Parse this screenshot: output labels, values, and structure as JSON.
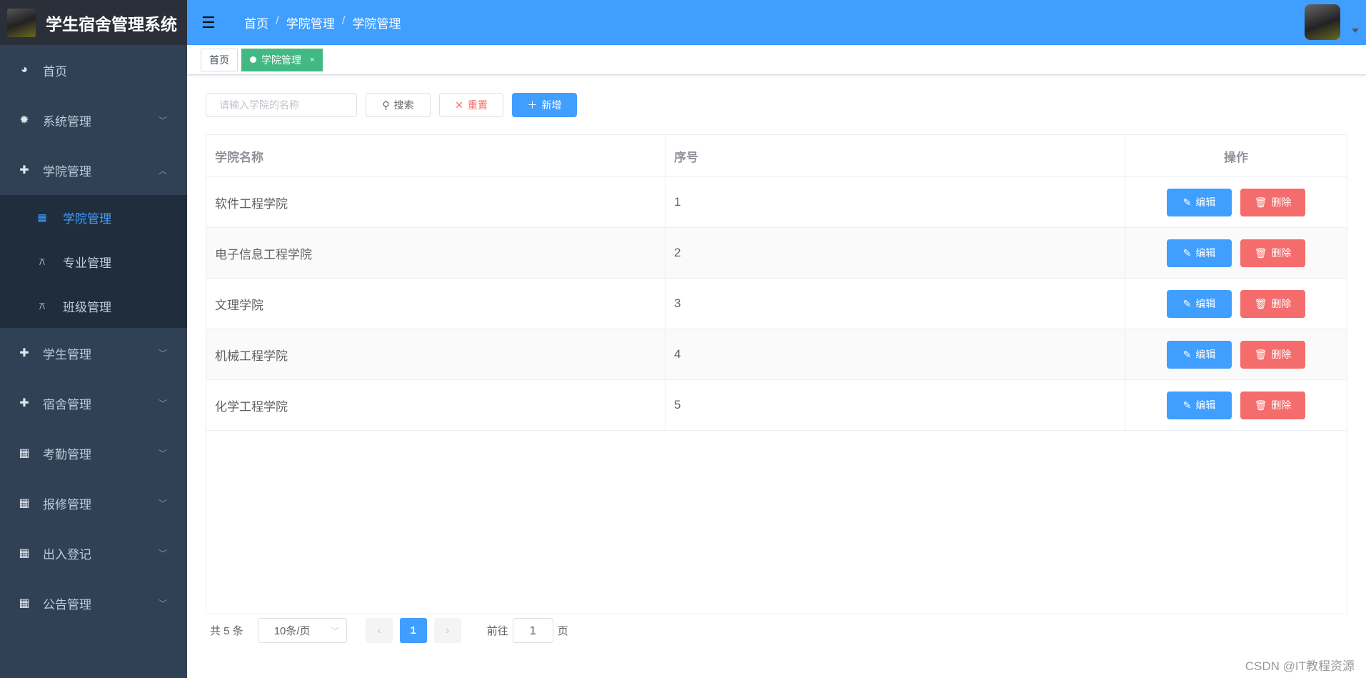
{
  "app": {
    "title": "学生宿舍管理系统"
  },
  "sidebar": {
    "items": [
      {
        "label": "首页",
        "icon": "dashboard-icon",
        "glyph": "◕"
      },
      {
        "label": "系统管理",
        "icon": "gear-icon",
        "glyph": "✹"
      },
      {
        "label": "学院管理",
        "icon": "circle-plus-icon",
        "glyph": "✚"
      },
      {
        "label": "学生管理",
        "icon": "circle-plus-icon",
        "glyph": "✚"
      },
      {
        "label": "宿舍管理",
        "icon": "circle-plus-icon",
        "glyph": "✚"
      },
      {
        "label": "考勤管理",
        "icon": "table-icon",
        "glyph": "▦"
      },
      {
        "label": "报修管理",
        "icon": "table-icon",
        "glyph": "▦"
      },
      {
        "label": "出入登记",
        "icon": "table-icon",
        "glyph": "▦"
      },
      {
        "label": "公告管理",
        "icon": "table-icon",
        "glyph": "▦"
      }
    ],
    "submenu": [
      {
        "label": "学院管理"
      },
      {
        "label": "专业管理"
      },
      {
        "label": "班级管理"
      }
    ]
  },
  "header": {
    "breadcrumb": [
      "首页",
      "学院管理",
      "学院管理"
    ],
    "separator": "/"
  },
  "tabs": [
    {
      "label": "首页"
    },
    {
      "label": "学院管理",
      "close": "×"
    }
  ],
  "toolbar": {
    "search_placeholder": "请输入学院的名称",
    "search": "搜索",
    "reset": "重置",
    "add": "新增"
  },
  "table": {
    "columns": [
      "学院名称",
      "序号",
      "操作"
    ],
    "rows": [
      {
        "name": "软件工程学院",
        "seq": "1"
      },
      {
        "name": "电子信息工程学院",
        "seq": "2"
      },
      {
        "name": "文理学院",
        "seq": "3"
      },
      {
        "name": "机械工程学院",
        "seq": "4"
      },
      {
        "name": "化学工程学院",
        "seq": "5"
      }
    ],
    "edit": "编辑",
    "delete": "删除"
  },
  "pagination": {
    "total": "共 5 条",
    "page_size": "10条/页",
    "current": "1",
    "goto_label": "前往",
    "goto_value": "1",
    "page_suffix": "页"
  },
  "watermark": "CSDN @IT教程资源",
  "colors": {
    "primary": "#409eff",
    "danger": "#f56c6c",
    "tab_active": "#42b983",
    "sidebar": "#304156"
  }
}
